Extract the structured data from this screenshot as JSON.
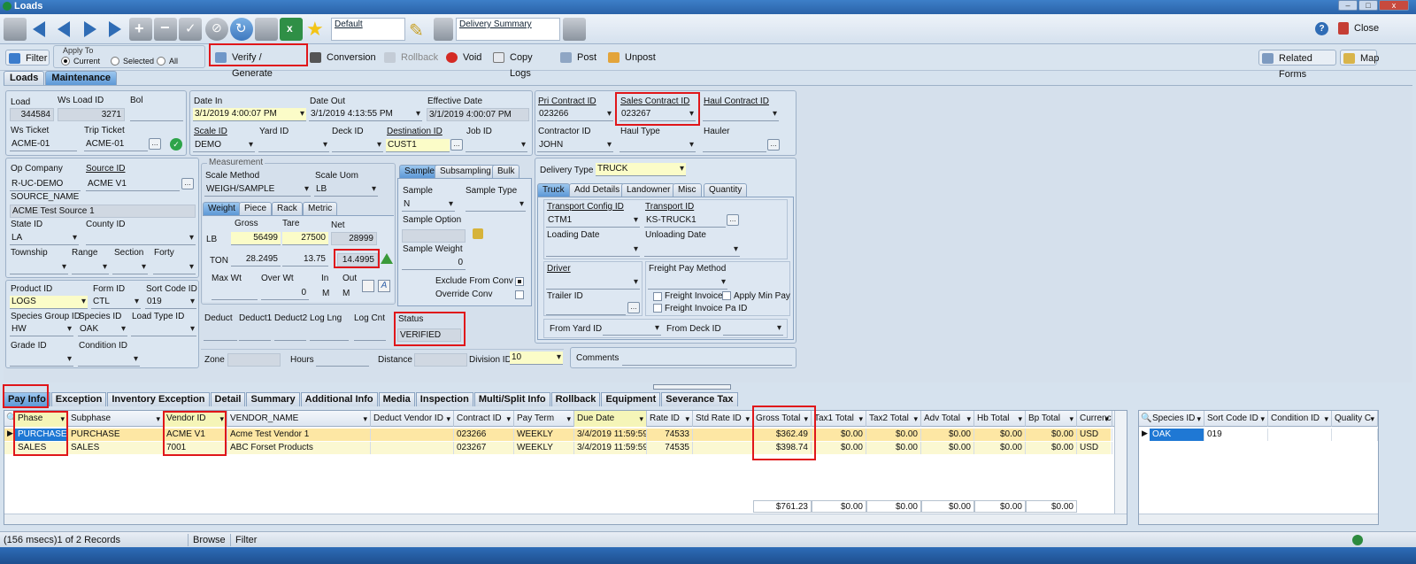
{
  "window": {
    "title": "Loads",
    "min": "–",
    "max": "□",
    "close": "x"
  },
  "toolbar": {
    "layout1": "Default",
    "layout2": "Delivery Summary",
    "help": "?",
    "close_label": "Close"
  },
  "actions": {
    "filter": "Filter",
    "apply_to_label": "Apply To",
    "apply_options": [
      "Current",
      "Selected",
      "All"
    ],
    "verify": "Verify / Generate",
    "conversion": "Conversion",
    "rollback": "Rollback",
    "void": "Void",
    "copy_logs": "Copy Logs",
    "post": "Post",
    "unpost": "Unpost",
    "related_forms": "Related Forms",
    "map": "Map"
  },
  "main_tabs": [
    "Loads",
    "Maintenance"
  ],
  "header": {
    "load_label": "Load",
    "load": "344584",
    "ws_load_id_label": "Ws Load ID",
    "ws_load_id": "3271",
    "bol_label": "Bol",
    "bol": "",
    "ws_ticket_label": "Ws Ticket",
    "ws_ticket": "ACME-01",
    "trip_ticket_label": "Trip Ticket",
    "trip_ticket": "ACME-01",
    "date_in_label": "Date In",
    "date_in": "3/1/2019 4:00:07 PM",
    "date_out_label": "Date Out",
    "date_out": "3/1/2019 4:13:55 PM",
    "effective_date_label": "Effective Date",
    "effective_date": "3/1/2019 4:00:07 PM",
    "scale_id_label": "Scale ID",
    "scale_id": "DEMO",
    "yard_id_label": "Yard ID",
    "deck_id_label": "Deck ID",
    "destination_id_label": "Destination ID",
    "destination_id": "CUST1",
    "job_id_label": "Job ID",
    "pri_contract_label": "Pri Contract ID",
    "pri_contract": "023266",
    "sales_contract_label": "Sales Contract ID",
    "sales_contract": "023267",
    "haul_contract_label": "Haul Contract ID",
    "contractor_label": "Contractor ID",
    "contractor": "JOHN",
    "haul_type_label": "Haul Type",
    "hauler_label": "Hauler"
  },
  "source": {
    "op_company_label": "Op Company",
    "op_company": "R-UC-DEMO",
    "source_id_label": "Source ID",
    "source_id": "ACME V1",
    "source_name_label": "SOURCE_NAME",
    "source_name": "ACME Test Source 1",
    "state_label": "State ID",
    "state": "LA",
    "county_label": "County ID",
    "township_label": "Township",
    "range_label": "Range",
    "section_label": "Section",
    "forty_label": "Forty",
    "product_label": "Product ID",
    "product": "LOGS",
    "form_label": "Form ID",
    "form": "CTL",
    "sort_code_label": "Sort Code ID",
    "sort_code": "019",
    "species_group_label": "Species Group ID",
    "species_group": "HW",
    "species_label": "Species ID",
    "species": "OAK",
    "load_type_label": "Load Type ID",
    "grade_label": "Grade ID",
    "condition_label": "Condition ID"
  },
  "measurement": {
    "title": "Measurement",
    "scale_method_label": "Scale Method",
    "scale_method": "WEIGH/SAMPLE",
    "scale_uom_label": "Scale Uom",
    "scale_uom": "LB",
    "tabs": [
      "Weight",
      "Piece",
      "Rack",
      "Metric"
    ],
    "gross_label": "Gross",
    "tare_label": "Tare",
    "net_label": "Net",
    "lb_label": "LB",
    "gross_lb": "56499",
    "tare_lb": "27500",
    "net_lb": "28999",
    "ton_label": "TON",
    "gross_ton": "28.2495",
    "tare_ton": "13.75",
    "net_ton": "14.4995",
    "max_wt_label": "Max Wt",
    "over_wt_label": "Over Wt",
    "over_wt": "0",
    "in_label": "In",
    "in": "M",
    "out_label": "Out",
    "out": "M",
    "deduct_label": "Deduct",
    "deduct1_label": "Deduct1",
    "deduct2_label": "Deduct2",
    "log_lng_label": "Log Lng",
    "log_cnt_label": "Log Cnt",
    "zone_label": "Zone",
    "hours_label": "Hours",
    "distance_label": "Distance"
  },
  "sample": {
    "tabs": [
      "Sample",
      "Subsampling",
      "Bulk"
    ],
    "sample_label": "Sample",
    "sample": "N",
    "sample_type_label": "Sample Type",
    "sample_option_label": "Sample Option",
    "sample_weight_label": "Sample Weight",
    "sample_weight": "0",
    "exclude_label": "Exclude From Conv",
    "override_label": "Override Conv",
    "status_label": "Status",
    "status": "VERIFIED",
    "division_label": "Division ID",
    "division": "10"
  },
  "delivery": {
    "type_label": "Delivery Type",
    "type": "TRUCK",
    "tabs": [
      "Truck",
      "Add Details",
      "Landowner",
      "Misc",
      "Quantity"
    ],
    "transport_config_label": "Transport Config ID",
    "transport_config": "CTM1",
    "transport_label": "Transport ID",
    "transport": "KS-TRUCK1",
    "loading_date_label": "Loading Date",
    "unloading_date_label": "Unloading Date",
    "driver_label": "Driver",
    "freight_pay_label": "Freight Pay Method",
    "freight_invoice_label": "Freight Invoice",
    "apply_min_pay_label": "Apply Min Pay",
    "freight_invoice_pa_label": "Freight Invoice Pa ID",
    "trailer_label": "Trailer ID",
    "from_yard_label": "From Yard ID",
    "from_deck_label": "From Deck ID",
    "comments_label": "Comments"
  },
  "bottom_tabs": [
    "Pay Info",
    "Exception",
    "Inventory Exception",
    "Detail",
    "Summary",
    "Additional Info",
    "Media",
    "Inspection",
    "Multi/Split Info",
    "Rollback",
    "Equipment",
    "Severance Tax"
  ],
  "pay_grid": {
    "columns": [
      "Phase",
      "Subphase",
      "Vendor ID",
      "VENDOR_NAME",
      "Deduct Vendor ID",
      "Contract ID",
      "Pay Term",
      "Due Date",
      "Rate ID",
      "Std Rate ID",
      "Gross Total",
      "Tax1 Total",
      "Tax2 Total",
      "Adv Total",
      "Hb Total",
      "Bp Total",
      "Currency"
    ],
    "rows": [
      [
        "PURCHASE",
        "PURCHASE",
        "ACME V1",
        "Acme Test Vendor 1",
        "",
        "023266",
        "WEEKLY",
        "3/4/2019 11:59:59",
        "74533",
        "",
        "$362.49",
        "$0.00",
        "$0.00",
        "$0.00",
        "$0.00",
        "$0.00",
        "USD"
      ],
      [
        "SALES",
        "SALES",
        "7001",
        "ABC Forset Products",
        "",
        "023267",
        "WEEKLY",
        "3/4/2019 11:59:59",
        "74535",
        "",
        "$398.74",
        "$0.00",
        "$0.00",
        "$0.00",
        "$0.00",
        "$0.00",
        "USD"
      ]
    ],
    "totals": [
      "$761.23",
      "$0.00",
      "$0.00",
      "$0.00",
      "$0.00",
      "$0.00"
    ]
  },
  "species_grid": {
    "columns": [
      "Species ID",
      "Sort Code ID",
      "Condition ID",
      "Quality C"
    ],
    "rows": [
      [
        "OAK",
        "019",
        "",
        ""
      ]
    ]
  },
  "status_bar": {
    "records": "(156 msecs)1 of 2 Records",
    "mode": "Browse",
    "filter": "Filter"
  }
}
